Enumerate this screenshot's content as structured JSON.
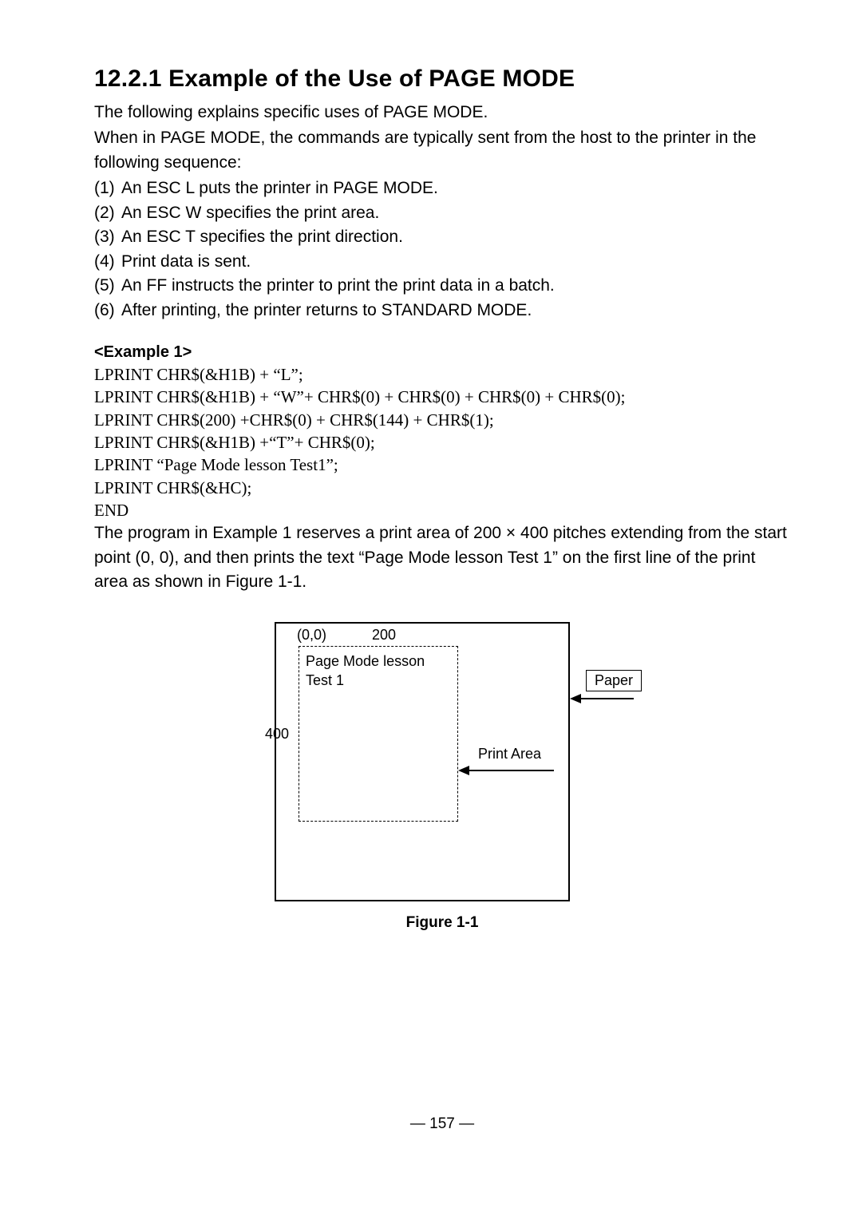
{
  "section": {
    "title": "12.2.1 Example of the Use of PAGE MODE",
    "intro1": "The following explains specific uses of PAGE MODE.",
    "intro2": "When in PAGE MODE, the commands are typically sent from the host to the printer in the following sequence:",
    "steps": [
      {
        "n": "(1)",
        "t": "An ESC L puts the printer in PAGE MODE."
      },
      {
        "n": "(2)",
        "t": "An ESC W specifies the print area."
      },
      {
        "n": "(3)",
        "t": "An ESC T specifies the print direction."
      },
      {
        "n": "(4)",
        "t": "Print data is sent."
      },
      {
        "n": "(5)",
        "t": "An FF instructs the printer to print the print data in a batch."
      },
      {
        "n": "(6)",
        "t": "After printing, the printer returns to STANDARD MODE."
      }
    ],
    "example_label": "<Example 1>",
    "code": "LPRINT CHR$(&H1B) + “L”;\nLPRINT CHR$(&H1B) + “W”+ CHR$(0) + CHR$(0) + CHR$(0) + CHR$(0);\nLPRINT CHR$(200) +CHR$(0) + CHR$(144) + CHR$(1);\nLPRINT CHR$(&H1B) +“T”+ CHR$(0);\nLPRINT “Page Mode lesson Test1”;\nLPRINT CHR$(&HC);\nEND",
    "explain": "The program in Example 1 reserves a print area of 200 × 400 pitches extending from the start point (0, 0), and then prints the text “Page Mode lesson Test 1” on the first line of the print area as shown in Figure 1-1."
  },
  "figure": {
    "coord": "(0,0)",
    "w": "200",
    "h": "400",
    "text1": "Page Mode lesson",
    "text2": "Test 1",
    "print_area_label": "Print Area",
    "paper_label": "Paper",
    "caption": "Figure 1-1"
  },
  "pagenum": "— 157 —"
}
